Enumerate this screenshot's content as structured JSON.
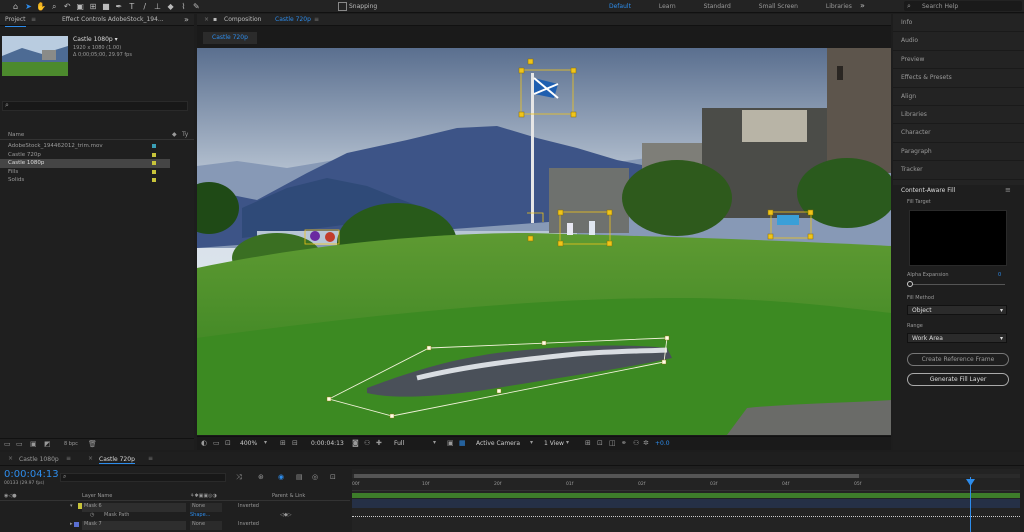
{
  "topbar": {
    "snapping_label": "Snapping",
    "workspaces": [
      "Default",
      "Learn",
      "Standard",
      "Small Screen",
      "Libraries"
    ],
    "active_workspace": "Default",
    "search_placeholder": "Search Help"
  },
  "left_panel": {
    "tabs": [
      "Project",
      "Effect Controls AdobeStock_194..."
    ],
    "preview_title": "Castle 1080p ▾",
    "preview_info": [
      "1920 x 1080 (1.00)",
      "Δ 0;00;05;00, 29.97 fps"
    ],
    "column_header": "Name",
    "items": [
      {
        "label": "AdobeStock_194462012_trim.mov",
        "color": "#3a9fb6",
        "selected": false
      },
      {
        "label": "Castle 720p",
        "color": "#c8c43a",
        "selected": false
      },
      {
        "label": "Castle 1080p",
        "color": "#c8c43a",
        "selected": true
      },
      {
        "label": "Fills",
        "color": "#c8c43a",
        "selected": false
      },
      {
        "label": "Solids",
        "color": "#c8c43a",
        "selected": false
      }
    ],
    "bpc_label": "8 bpc"
  },
  "composition": {
    "tab_prefix": "Composition",
    "tab_name": "Castle 720p",
    "sub_tab": "Castle 720p",
    "zoom": "400%",
    "timecode": "0:00:04:13",
    "resolution": "Full",
    "camera": "Active Camera",
    "view": "1 View",
    "exposure": "+0.0"
  },
  "right_panel": {
    "items": [
      "Info",
      "Audio",
      "Preview",
      "Effects & Presets",
      "Align",
      "Libraries",
      "Character",
      "Paragraph",
      "Tracker"
    ],
    "caf_title": "Content-Aware Fill",
    "fill_target_label": "Fill Target",
    "alpha_label": "Alpha Expansion",
    "alpha_value": "0",
    "fill_method_label": "Fill Method",
    "fill_method_value": "Object",
    "range_label": "Range",
    "range_value": "Work Area",
    "create_ref_button": "Create Reference Frame",
    "generate_button": "Generate Fill Layer"
  },
  "timeline": {
    "tabs": [
      "Castle 1080p",
      "Castle 720p"
    ],
    "active_tab": "Castle 720p",
    "timecode": "0:00:04:13",
    "frame_info": "00133 (29.97 fps)",
    "headers": {
      "layer_name": "Layer Name",
      "parent": "Parent & Link"
    },
    "layers": [
      {
        "num": "",
        "name": "Mask 6",
        "mode": "None",
        "extra": "Inverted"
      },
      {
        "num": "",
        "name": "Mask Path",
        "mode": "Shape...",
        "extra": ""
      },
      {
        "num": "",
        "name": "Mask 7",
        "mode": "None",
        "extra": "Inverted"
      }
    ],
    "ruler_labels": [
      "00f",
      "10f",
      "20f",
      "01f",
      "02f",
      "03f",
      "04f",
      "05f"
    ]
  },
  "colors": {
    "accent": "#2d8ceb",
    "mask_yellow": "#f0c419",
    "label_yellow": "#c8c43a",
    "work_area": "#3d7d2a"
  }
}
